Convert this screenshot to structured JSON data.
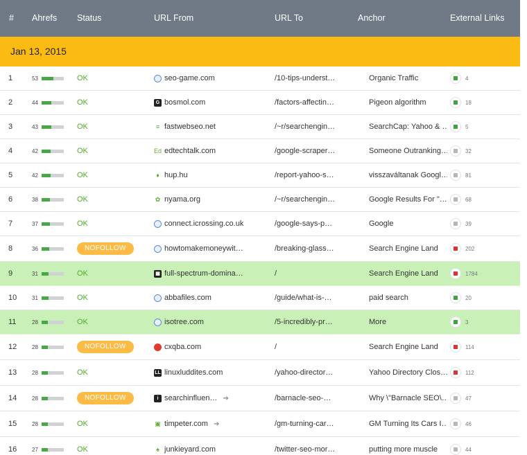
{
  "headers": {
    "num": "#",
    "ahrefs": "Ahrefs",
    "status": "Status",
    "url_from": "URL From",
    "url_to": "URL To",
    "anchor": "Anchor",
    "external_links": "External Links"
  },
  "date_group": "Jan 13, 2015",
  "colors": {
    "header_bg": "#6f7a86",
    "date_band": "#fbbb12",
    "highlight_row": "#c9f1b7",
    "ok_text": "#4caf27",
    "nofollow_pill": "#fbbb44",
    "rank_bar": "#48a848"
  },
  "rows": [
    {
      "num": "1",
      "ahrefs": "53",
      "rank": 0.53,
      "status": "OK",
      "nofollow": false,
      "icon": "globe-icon",
      "from": "seo-game.com",
      "arrow": false,
      "to": "/10-tips-underst…",
      "anchor": "Organic Traffic",
      "ext_indicator": "green",
      "ext": "4",
      "highlight": false
    },
    {
      "num": "2",
      "ahrefs": "44",
      "rank": 0.44,
      "status": "OK",
      "nofollow": false,
      "icon": "bosmol-icon",
      "from": "bosmol.com",
      "arrow": false,
      "to": "/factors-affectin…",
      "anchor": "Pigeon algorithm",
      "ext_indicator": "green",
      "ext": "18",
      "highlight": false
    },
    {
      "num": "3",
      "ahrefs": "43",
      "rank": 0.43,
      "status": "OK",
      "nofollow": false,
      "icon": "fastwebseo-icon",
      "from": "fastwebseo.net",
      "arrow": false,
      "to": "/~r/searchengin…",
      "anchor": "SearchCap: Yahoo & …",
      "ext_indicator": "green",
      "ext": "5",
      "highlight": false
    },
    {
      "num": "4",
      "ahrefs": "42",
      "rank": 0.42,
      "status": "OK",
      "nofollow": false,
      "icon": "edtech-icon",
      "from": "edtechtalk.com",
      "arrow": false,
      "to": "/google-scraper…",
      "anchor": "Someone Outranking…",
      "ext_indicator": "gray",
      "ext": "32",
      "highlight": false
    },
    {
      "num": "5",
      "ahrefs": "42",
      "rank": 0.42,
      "status": "OK",
      "nofollow": false,
      "icon": "hup-icon",
      "from": "hup.hu",
      "arrow": false,
      "to": "/report-yahoo-s…",
      "anchor": "visszaváltanak Googl…",
      "ext_indicator": "gray",
      "ext": "81",
      "highlight": false
    },
    {
      "num": "6",
      "ahrefs": "38",
      "rank": 0.38,
      "status": "OK",
      "nofollow": false,
      "icon": "nyama-icon",
      "from": "nyama.org",
      "arrow": false,
      "to": "/~r/searchengin…",
      "anchor": "Google Results For \"…",
      "ext_indicator": "gray",
      "ext": "68",
      "highlight": false
    },
    {
      "num": "7",
      "ahrefs": "37",
      "rank": 0.37,
      "status": "OK",
      "nofollow": false,
      "icon": "globe-icon",
      "from": "connect.icrossing.co.uk",
      "arrow": false,
      "to": "/google-says-p…",
      "anchor": "Google",
      "ext_indicator": "gray",
      "ext": "39",
      "highlight": false
    },
    {
      "num": "8",
      "ahrefs": "36",
      "rank": 0.36,
      "status": "NOFOLLOW",
      "nofollow": true,
      "icon": "globe-icon",
      "from": "howtomakemoneywit…",
      "arrow": false,
      "to": "/breaking-glass…",
      "anchor": "Search Engine Land",
      "ext_indicator": "red",
      "ext": "202",
      "highlight": false
    },
    {
      "num": "9",
      "ahrefs": "31",
      "rank": 0.31,
      "status": "OK",
      "nofollow": false,
      "icon": "spectrum-icon",
      "from": "full-spectrum-domina…",
      "arrow": false,
      "to": "/",
      "anchor": "Search Engine Land",
      "ext_indicator": "red",
      "ext": "1784",
      "highlight": true
    },
    {
      "num": "10",
      "ahrefs": "31",
      "rank": 0.31,
      "status": "OK",
      "nofollow": false,
      "icon": "globe-icon",
      "from": "abbafiles.com",
      "arrow": false,
      "to": "/guide/what-is-…",
      "anchor": "paid search",
      "ext_indicator": "green",
      "ext": "20",
      "highlight": false
    },
    {
      "num": "11",
      "ahrefs": "28",
      "rank": 0.28,
      "status": "OK",
      "nofollow": false,
      "icon": "globe-icon",
      "from": "isotree.com",
      "arrow": false,
      "to": "/5-incredibly-pr…",
      "anchor": "More",
      "ext_indicator": "green",
      "ext": "3",
      "highlight": true
    },
    {
      "num": "12",
      "ahrefs": "28",
      "rank": 0.28,
      "status": "NOFOLLOW",
      "nofollow": true,
      "icon": "cxqba-icon",
      "from": "cxqba.com",
      "arrow": false,
      "to": "/",
      "anchor": "Search Engine Land",
      "ext_indicator": "red",
      "ext": "114",
      "highlight": false
    },
    {
      "num": "13",
      "ahrefs": "28",
      "rank": 0.28,
      "status": "OK",
      "nofollow": false,
      "icon": "linuxluddites-icon",
      "from": "linuxluddites.com",
      "arrow": false,
      "to": "/yahoo-director…",
      "anchor": "Yahoo Directory Clos…",
      "ext_indicator": "red",
      "ext": "112",
      "highlight": false
    },
    {
      "num": "14",
      "ahrefs": "28",
      "rank": 0.28,
      "status": "NOFOLLOW",
      "nofollow": true,
      "icon": "searchinfluence-icon",
      "from": "searchinfluen…",
      "arrow": true,
      "to": "/barnacle-seo-…",
      "anchor": "Why \\\"Barnacle SEO\\…",
      "ext_indicator": "gray",
      "ext": "47",
      "highlight": false
    },
    {
      "num": "15",
      "ahrefs": "28",
      "rank": 0.28,
      "status": "OK",
      "nofollow": false,
      "icon": "timpeter-icon",
      "from": "timpeter.com",
      "arrow": true,
      "to": "/gm-turning-car…",
      "anchor": "GM Turning Its Cars I…",
      "ext_indicator": "gray",
      "ext": "46",
      "highlight": false
    },
    {
      "num": "16",
      "ahrefs": "27",
      "rank": 0.27,
      "status": "OK",
      "nofollow": false,
      "icon": "junkieyard-icon",
      "from": "junkieyard.com",
      "arrow": false,
      "to": "/twitter-seo-mor…",
      "anchor": "putting more muscle",
      "ext_indicator": "gray",
      "ext": "44",
      "highlight": false
    }
  ]
}
